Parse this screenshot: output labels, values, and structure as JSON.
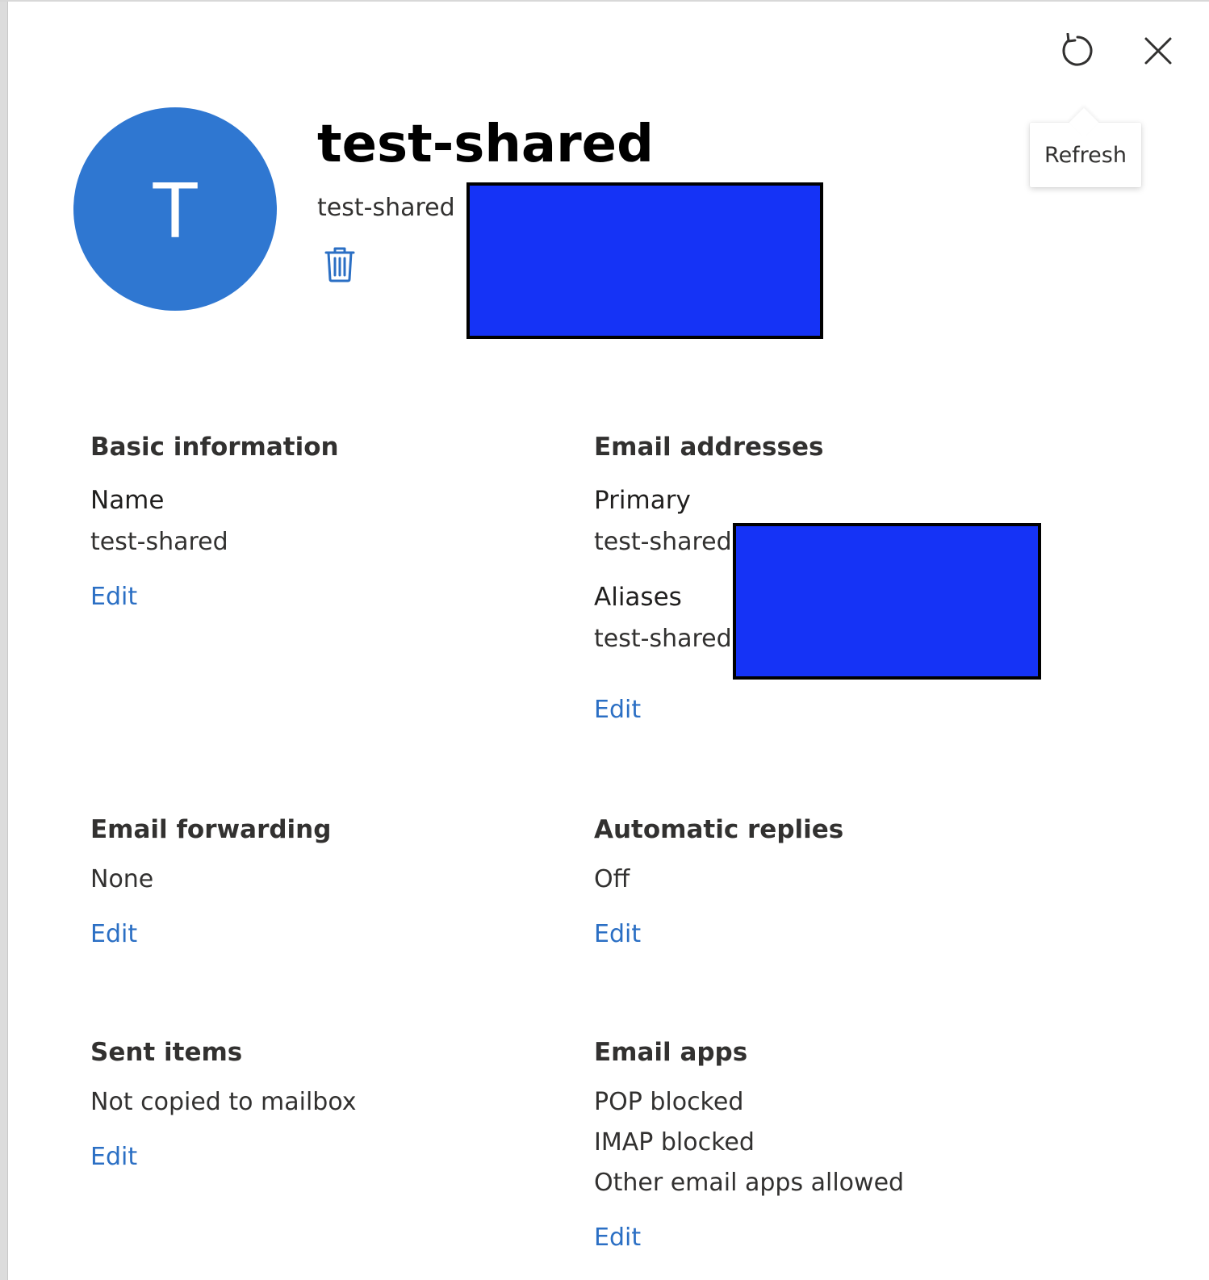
{
  "header": {
    "refresh_tooltip": "Refresh",
    "title": "test-shared",
    "subtitle": "test-shared",
    "avatar_initial": "T"
  },
  "sections": {
    "basic_information": {
      "heading": "Basic information",
      "name_label": "Name",
      "name_value": "test-shared",
      "edit_label": "Edit"
    },
    "email_addresses": {
      "heading": "Email addresses",
      "primary_label": "Primary",
      "primary_value": "test-shared",
      "aliases_label": "Aliases",
      "aliases_value": "test-shared",
      "edit_label": "Edit"
    },
    "email_forwarding": {
      "heading": "Email forwarding",
      "value": "None",
      "edit_label": "Edit"
    },
    "automatic_replies": {
      "heading": "Automatic replies",
      "value": "Off",
      "edit_label": "Edit"
    },
    "sent_items": {
      "heading": "Sent items",
      "value": "Not copied to mailbox",
      "edit_label": "Edit"
    },
    "email_apps": {
      "heading": "Email apps",
      "values": [
        "POP blocked",
        "IMAP blocked",
        "Other email apps allowed"
      ],
      "edit_label": "Edit"
    }
  },
  "colors": {
    "avatar": "#2f77d1",
    "link": "#2b6fc4",
    "redaction": "#1533f6"
  },
  "icons": {
    "refresh": "refresh-icon",
    "close": "close-icon",
    "delete": "trash-icon"
  }
}
